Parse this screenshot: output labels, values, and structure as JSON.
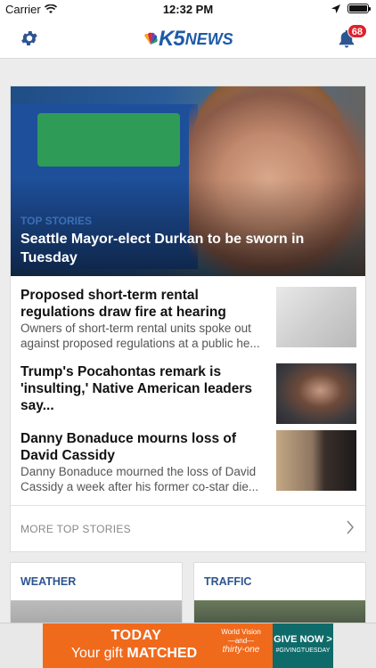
{
  "status_bar": {
    "carrier": "Carrier",
    "time": "12:32 PM"
  },
  "header": {
    "logo_k5": "K5",
    "logo_news": "NEWS",
    "notification_count": "68"
  },
  "hero": {
    "category": "TOP STORIES",
    "title": "Seattle Mayor-elect Durkan to be sworn in Tuesday"
  },
  "stories": [
    {
      "headline": "Proposed short-term rental regulations draw fire at hearing",
      "summary_line1": "Owners of short-term rental units spoke out",
      "summary_line2": "against proposed regulations at a public he..."
    },
    {
      "headline": "Trump's Pocahontas remark is 'insulting,' Native American leaders say..."
    },
    {
      "headline": "Danny Bonaduce mourns loss of David Cassidy",
      "summary_line1": "Danny Bonaduce mourned the loss of David",
      "summary_line2": "Cassidy a week after his former co-star die..."
    }
  ],
  "more_label": "MORE TOP STORIES",
  "sections": {
    "weather": "WEATHER",
    "traffic": "TRAFFIC"
  },
  "ad": {
    "line1": "TODAY",
    "line2_prefix": "Your gift ",
    "line2_bold": "MATCHED",
    "sponsor_line1": "World Vision",
    "sponsor_line2": "—and—",
    "sponsor_line3": "thirty-one",
    "cta": "GIVE NOW >",
    "hashtag": "#GIVINGTUESDAY"
  },
  "colors": {
    "accent_blue": "#2d5592",
    "badge_red": "#e0212b",
    "ad_orange": "#f06a1c",
    "ad_teal": "#0f6b6a"
  }
}
